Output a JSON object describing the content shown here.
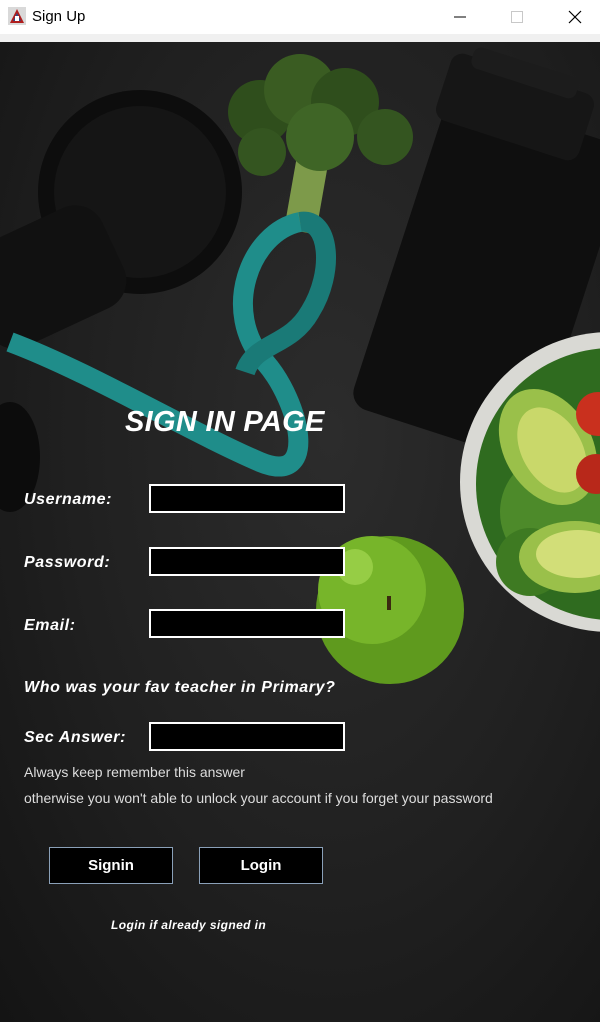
{
  "window": {
    "title": "Sign Up",
    "icons": {
      "app": "app-icon",
      "minimize": "minimize-icon",
      "maximize": "maximize-icon",
      "close": "close-icon"
    }
  },
  "form": {
    "heading": "SIGN IN PAGE",
    "username_label": "Username:",
    "username_value": "",
    "password_label": "Password:",
    "password_value": "",
    "email_label": "Email:",
    "email_value": "",
    "security_question": "Who was your fav teacher in Primary?",
    "sec_answer_label": "Sec Answer:",
    "sec_answer_value": "",
    "note_line1": "Always keep remember this answer",
    "note_line2": "otherwise you won't able to unlock your account if you forget your password",
    "signin_button": "Signin",
    "login_button": "Login",
    "footer_note": "Login if already signed in"
  },
  "colors": {
    "field_border": "#ffffff",
    "field_background": "#000000",
    "button_border": "#8aa0b8",
    "text": "#ffffff"
  }
}
